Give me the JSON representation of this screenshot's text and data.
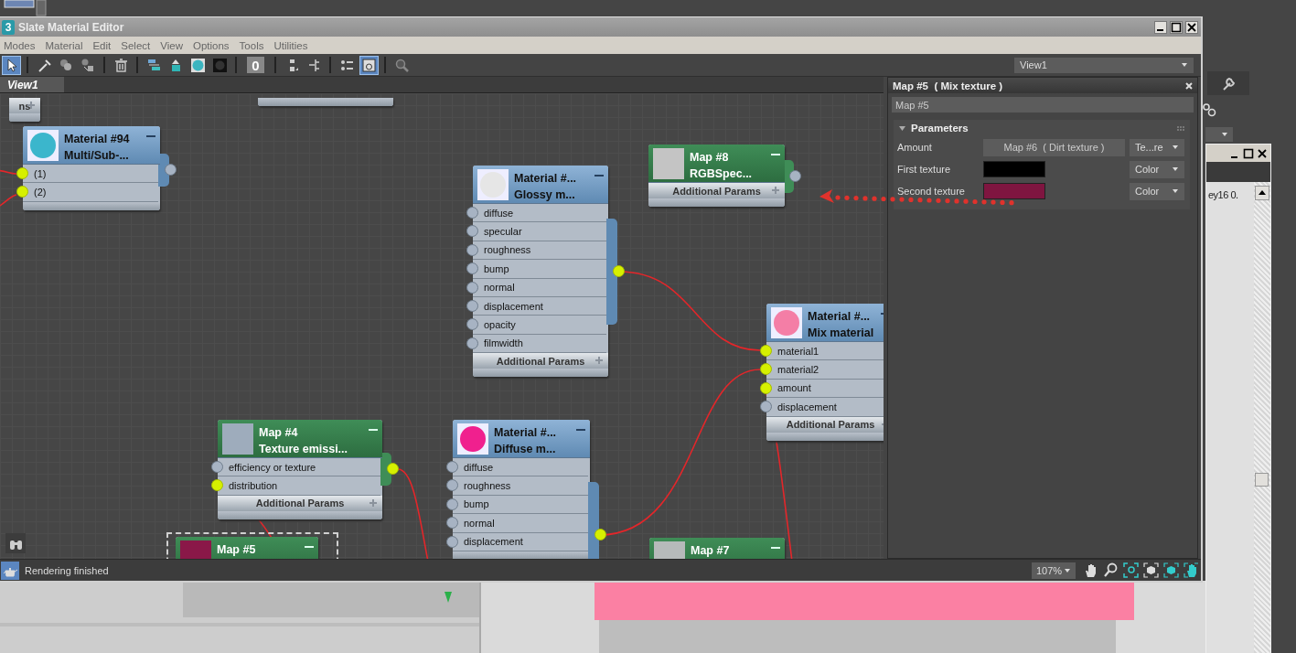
{
  "window": {
    "app_icon": "3",
    "title": "Slate Material Editor"
  },
  "menu": [
    "Modes",
    "Material",
    "Edit",
    "Select",
    "View",
    "Options",
    "Tools",
    "Utilities"
  ],
  "toolbar": [
    [
      {
        "selected": true
      }
    ],
    [
      {
        "selected": false
      },
      {
        "selected": false
      },
      {
        "selected": false
      }
    ],
    [
      {
        "selected": false
      }
    ],
    [
      {
        "selected": false
      },
      {
        "selected": false
      },
      {
        "selected": false
      },
      {
        "selected": false
      }
    ],
    [
      {
        "label": "0",
        "selected": false
      }
    ],
    [
      {
        "selected": false
      },
      {
        "selected": false
      }
    ],
    [
      {
        "selected": false
      },
      {
        "selected": true
      }
    ],
    [
      {
        "selected": false
      }
    ]
  ],
  "view_dropdown": "View1",
  "view_tab": {
    "label": "View1",
    "selected": true
  },
  "nodes": [
    {
      "kind": "material",
      "footer": "ns",
      "selected": false
    },
    {
      "kind": "material",
      "selected": false
    },
    {
      "kind": "material",
      "title": "Material #94",
      "type": "Multi/Sub-...",
      "color": "#3bb6cc",
      "slots": [
        {
          "label": "(1)",
          "connected": true
        },
        {
          "label": "(2)",
          "connected": true
        }
      ],
      "output_connected": false,
      "selected": false
    },
    {
      "kind": "material",
      "title": "Material #...",
      "type": "Glossy m...",
      "color": "#e6e6e6",
      "slots": [
        {
          "label": "diffuse",
          "connected": false
        },
        {
          "label": "specular",
          "connected": false
        },
        {
          "label": "roughness",
          "connected": false
        },
        {
          "label": "bump",
          "connected": false
        },
        {
          "label": "normal",
          "connected": false
        },
        {
          "label": "displacement",
          "connected": false
        },
        {
          "label": "opacity",
          "connected": false
        },
        {
          "label": "filmwidth",
          "connected": false
        }
      ],
      "footer": "Additional Params",
      "output_connected": true,
      "selected": false
    },
    {
      "kind": "map",
      "title": "Map #8",
      "type": "RGBSpec...",
      "color": "#c4c4c4",
      "footer": "Additional Params",
      "output_connected": false,
      "selected": false
    },
    {
      "kind": "material",
      "title": "Material #...",
      "type": "Mix material",
      "color": "#f47ea6",
      "slots": [
        {
          "label": "material1",
          "connected": true
        },
        {
          "label": "material2",
          "connected": true
        },
        {
          "label": "amount",
          "connected": true
        },
        {
          "label": "displacement",
          "connected": false
        }
      ],
      "footer": "Additional Params",
      "selected": false
    },
    {
      "kind": "map",
      "title": "Map #4",
      "type": "Texture emissi...",
      "color": "#9eacbc",
      "slots": [
        {
          "label": "efficiency or texture",
          "connected": false
        },
        {
          "label": "distribution",
          "connected": true
        }
      ],
      "footer": "Additional Params",
      "output_connected": true,
      "selected": false
    },
    {
      "kind": "material",
      "title": "Material #...",
      "type": "Diffuse m...",
      "color": "#f0208e",
      "slots": [
        {
          "label": "diffuse",
          "connected": false
        },
        {
          "label": "roughness",
          "connected": false
        },
        {
          "label": "bump",
          "connected": false
        },
        {
          "label": "normal",
          "connected": false
        },
        {
          "label": "displacement",
          "connected": false
        }
      ],
      "output_connected": true,
      "selected": false
    },
    {
      "kind": "map",
      "title": "Map #5",
      "color": "#8a1848",
      "selected": true
    },
    {
      "kind": "map",
      "title": "Map #7",
      "color": "#b6baba",
      "selected": false
    }
  ],
  "panel": {
    "title": "Map #5  ( Mix texture )",
    "name": "Map #5",
    "rollout": {
      "title": "Parameters",
      "expanded": true,
      "rows": [
        {
          "label": "Amount",
          "kind": "map",
          "value": "Map #6  ( Dirt texture )",
          "mode": "Te...re"
        },
        {
          "label": "First texture",
          "kind": "color",
          "color": "#000000",
          "mode": "Color"
        },
        {
          "label": "Second texture",
          "kind": "color",
          "color": "#7f1540",
          "mode": "Color"
        }
      ]
    }
  },
  "status": {
    "message": "Rendering finished",
    "zoom": "107%"
  },
  "background_window": {
    "text": "ey16 0."
  }
}
